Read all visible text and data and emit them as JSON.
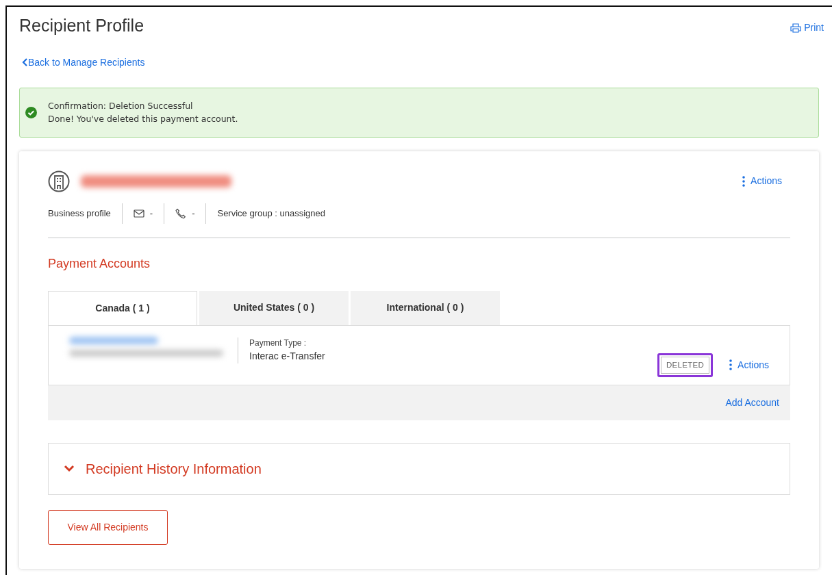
{
  "page": {
    "title": "Recipient Profile",
    "print_link": "Print",
    "back_link": "Back to Manage Recipients"
  },
  "alert": {
    "kind": "success",
    "title": "Confirmation: Deletion Successful",
    "message": "Done! You've deleted this payment account."
  },
  "profile": {
    "actions_label": "Actions",
    "type": "Business profile",
    "email": "-",
    "phone": "-",
    "service_group": "Service group : unassigned"
  },
  "payment_accounts": {
    "title": "Payment Accounts",
    "tabs": [
      {
        "label": "Canada ( 1 )",
        "selected": true
      },
      {
        "label": "United States ( 0 )",
        "selected": false
      },
      {
        "label": "International ( 0 )",
        "selected": false
      }
    ],
    "accounts": [
      {
        "payment_type_label": "Payment Type :",
        "payment_type": "Interac e-Transfer",
        "status": "DELETED",
        "highlighted": true,
        "actions_label": "Actions"
      }
    ],
    "add_account": "Add Account"
  },
  "history": {
    "title": "Recipient History Information"
  },
  "view_all_button": "View All Recipients"
}
